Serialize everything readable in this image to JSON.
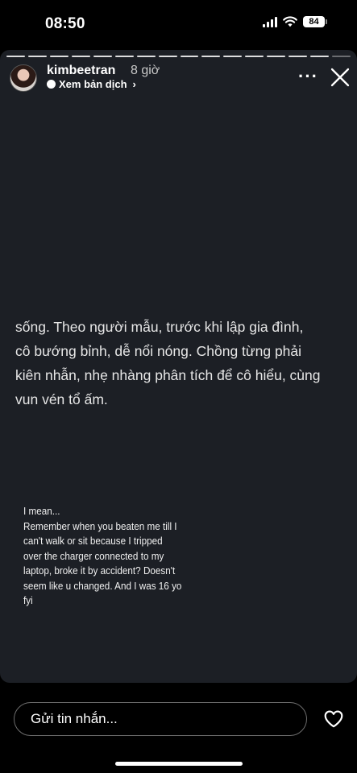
{
  "status_bar": {
    "time": "08:50",
    "battery": "84"
  },
  "story": {
    "progress_segments_total": 16,
    "progress_segments_seen": 15,
    "username": "kimbeetran",
    "time_ago": "8 giờ",
    "translate_label": "Xem bản dịch",
    "text_lines": [
      "sống. Theo người mẫu, trước khi lập gia đình,",
      "cô bướng bỉnh, dễ nổi nóng. Chồng từng phải",
      "kiên nhẫn, nhẹ nhàng phân tích để cô hiểu, cùng",
      "vun vén tổ ấm."
    ],
    "comment_lines": [
      "I mean...",
      "Remember when you beaten me till I",
      "can't walk or sit because I tripped",
      "over the charger connected to my",
      "laptop, broke it by accident? Doesn't",
      "seem like u changed. And I was 16 yo",
      "fyi"
    ]
  },
  "reply": {
    "placeholder": "Gửi tin nhắn..."
  },
  "icons": {
    "more": "more-icon",
    "close": "close-icon",
    "heart": "heart-icon",
    "wifi": "wifi-icon",
    "signal": "signal-icon",
    "battery": "battery-icon"
  }
}
